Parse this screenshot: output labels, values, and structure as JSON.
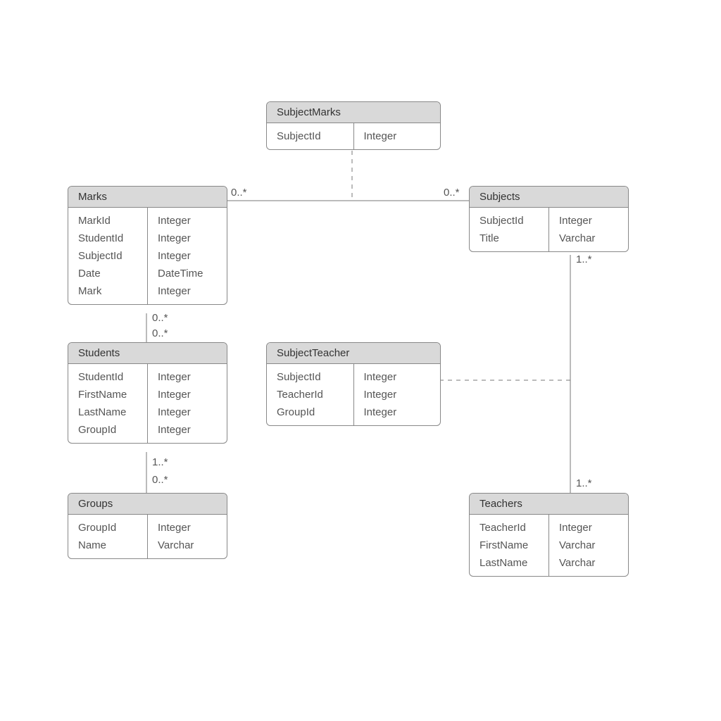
{
  "entities": {
    "subjectmarks": {
      "title": "SubjectMarks",
      "attrs": [
        {
          "name": "SubjectId",
          "type": "Integer"
        }
      ]
    },
    "marks": {
      "title": "Marks",
      "attrs": [
        {
          "name": "MarkId",
          "type": "Integer"
        },
        {
          "name": "StudentId",
          "type": "Integer"
        },
        {
          "name": "SubjectId",
          "type": "Integer"
        },
        {
          "name": "Date",
          "type": "DateTime"
        },
        {
          "name": "Mark",
          "type": "Integer"
        }
      ]
    },
    "subjects": {
      "title": "Subjects",
      "attrs": [
        {
          "name": "SubjectId",
          "type": "Integer"
        },
        {
          "name": "Title",
          "type": "Varchar"
        }
      ]
    },
    "students": {
      "title": "Students",
      "attrs": [
        {
          "name": "StudentId",
          "type": "Integer"
        },
        {
          "name": "FirstName",
          "type": "Integer"
        },
        {
          "name": "LastName",
          "type": "Integer"
        },
        {
          "name": "GroupId",
          "type": "Integer"
        }
      ]
    },
    "subjectteacher": {
      "title": "SubjectTeacher",
      "attrs": [
        {
          "name": "SubjectId",
          "type": "Integer"
        },
        {
          "name": "TeacherId",
          "type": "Integer"
        },
        {
          "name": "GroupId",
          "type": "Integer"
        }
      ]
    },
    "groups": {
      "title": "Groups",
      "attrs": [
        {
          "name": "GroupId",
          "type": "Integer"
        },
        {
          "name": "Name",
          "type": "Varchar"
        }
      ]
    },
    "teachers": {
      "title": "Teachers",
      "attrs": [
        {
          "name": "TeacherId",
          "type": "Integer"
        },
        {
          "name": "FirstName",
          "type": "Varchar"
        },
        {
          "name": "LastName",
          "type": "Varchar"
        }
      ]
    }
  },
  "cardinalities": {
    "marks_to_subjects_left": "0..*",
    "marks_to_subjects_right": "0..*",
    "marks_to_students_top": "0..*",
    "marks_to_students_bottom": "0..*",
    "students_to_groups_top": "1..*",
    "students_to_groups_bottom": "0..*",
    "subjects_to_teachers_top": "1..*",
    "subjects_to_teachers_bottom": "1..*"
  }
}
